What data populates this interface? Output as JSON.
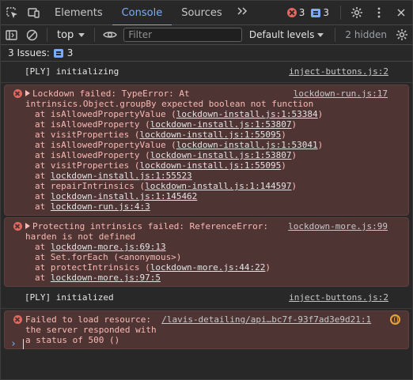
{
  "tabs": [
    {
      "label": "Elements"
    },
    {
      "label": "Console"
    },
    {
      "label": "Sources"
    }
  ],
  "counters": {
    "errors": "3",
    "messages": "3"
  },
  "toolbar": {
    "context": "top",
    "filter_placeholder": "Filter",
    "levels": "Default levels",
    "hidden": "2 hidden"
  },
  "issues": {
    "label": "3 Issues:",
    "count": "3"
  },
  "messages": {
    "m1": {
      "text": "[PLY] initializing",
      "src": "inject-buttons.js:2"
    },
    "m2": {
      "title": "Lockdown failed: TypeError: At",
      "title2": "intrinsics.Object.groupBy expected boolean not function",
      "src": "lockdown-run.js:17",
      "stack": [
        {
          "prefix": "at isAllowedPropertyValue (",
          "link": "lockdown-install.js:1:53384",
          "suffix": ")"
        },
        {
          "prefix": "at isAllowedProperty (",
          "link": "lockdown-install.js:1:53807",
          "suffix": ")"
        },
        {
          "prefix": "at visitProperties (",
          "link": "lockdown-install.js:1:55095",
          "suffix": ")"
        },
        {
          "prefix": "at isAllowedPropertyValue (",
          "link": "lockdown-install.js:1:53041",
          "suffix": ")"
        },
        {
          "prefix": "at isAllowedProperty (",
          "link": "lockdown-install.js:1:53807",
          "suffix": ")"
        },
        {
          "prefix": "at visitProperties (",
          "link": "lockdown-install.js:1:55095",
          "suffix": ")"
        },
        {
          "prefix": "at ",
          "link": "lockdown-install.js:1:55523",
          "suffix": ""
        },
        {
          "prefix": "at repairIntrinsics (",
          "link": "lockdown-install.js:1:144597",
          "suffix": ")"
        },
        {
          "prefix": "at ",
          "link": "lockdown-install.js:1:145462",
          "suffix": ""
        },
        {
          "prefix": "at ",
          "link": "lockdown-run.js:4:3",
          "suffix": ""
        }
      ]
    },
    "m3": {
      "title": "Protecting intrinsics failed: ReferenceError:",
      "title2": "harden is not defined",
      "src": "lockdown-more.js:99",
      "stack": [
        {
          "prefix": "at ",
          "link": "lockdown-more.js:69:13",
          "suffix": ""
        },
        {
          "prefix": "at Set.forEach (<anonymous>)",
          "link": "",
          "suffix": ""
        },
        {
          "prefix": "at protectIntrinsics (",
          "link": "lockdown-more.js:44:22",
          "suffix": ")"
        },
        {
          "prefix": "at ",
          "link": "lockdown-more.js:97:5",
          "suffix": ""
        }
      ]
    },
    "m4": {
      "text": "[PLY] initialized",
      "src": "inject-buttons.js:2"
    },
    "m5": {
      "line1": "Failed to load resource:",
      "url": "/lavis-detailing/api…bc7f-93f7ad3e9d21:1",
      "line2": "the server responded with",
      "line3": "a status of 500 ()"
    }
  },
  "prompt": {
    "symbol": "›"
  }
}
